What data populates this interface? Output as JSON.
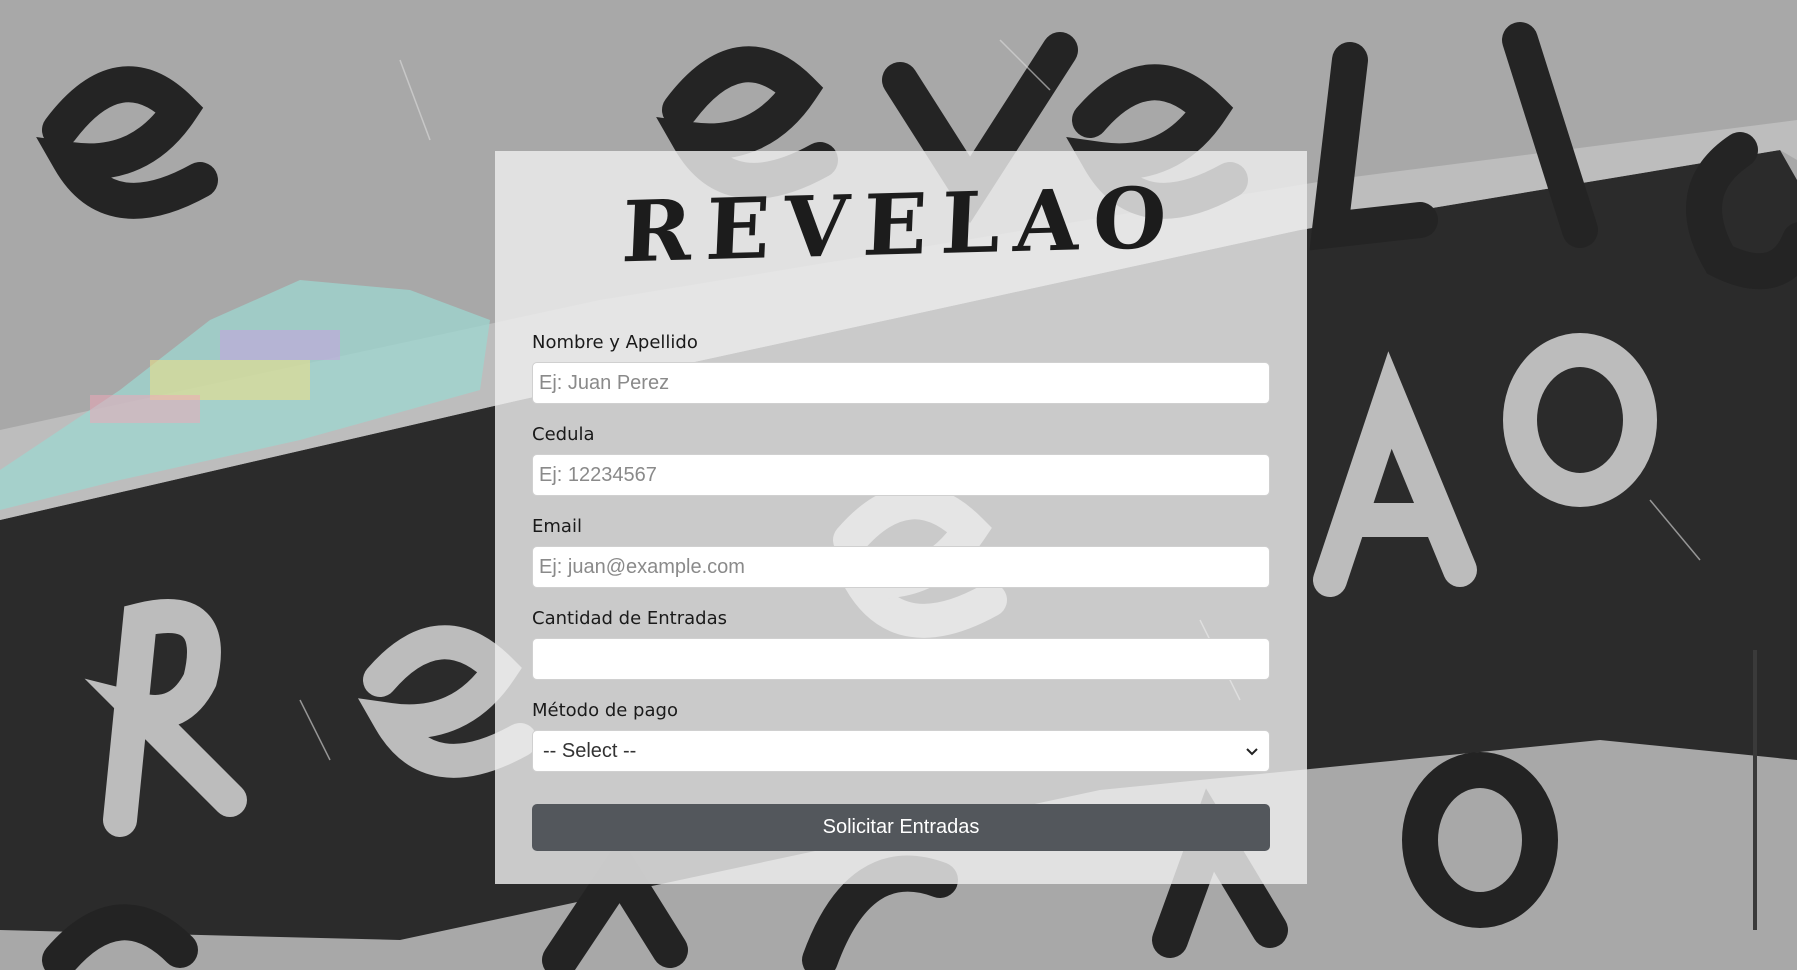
{
  "logo": {
    "text": "REVELAO"
  },
  "form": {
    "name": {
      "label": "Nombre y Apellido",
      "placeholder": "Ej: Juan Perez",
      "value": ""
    },
    "cedula": {
      "label": "Cedula",
      "placeholder": "Ej: 12234567",
      "value": ""
    },
    "email": {
      "label": "Email",
      "placeholder": "Ej: juan@example.com",
      "value": ""
    },
    "quantity": {
      "label": "Cantidad de Entradas",
      "placeholder": "",
      "value": ""
    },
    "payment": {
      "label": "Método de pago",
      "selected": "-- Select --"
    },
    "submit_label": "Solicitar Entradas"
  },
  "icons": {
    "select_arrow": "chevron-down-icon"
  },
  "colors": {
    "button": "#53575c",
    "card": "#eeeeee"
  }
}
